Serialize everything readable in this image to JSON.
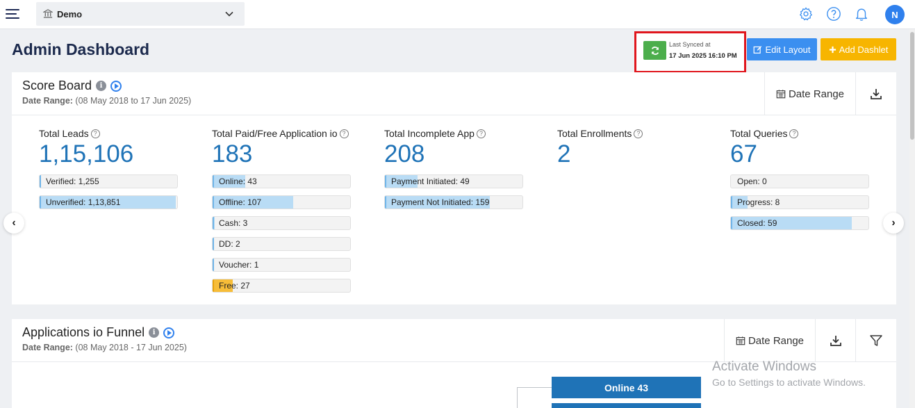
{
  "topbar": {
    "institution": "Demo",
    "avatar_initial": "N"
  },
  "page_title": "Admin Dashboard",
  "sync": {
    "label": "Last Synced at",
    "time": "17 Jun 2025 16:10 PM"
  },
  "buttons": {
    "edit_layout": "Edit Layout",
    "add_dashlet": "Add Dashlet"
  },
  "scoreboard": {
    "title": "Score Board",
    "date_label": "Date Range:",
    "date_value": "(08 May 2018 to 17 Jun 2025)",
    "date_range_btn": "Date Range",
    "stats": [
      {
        "label": "Total Leads",
        "value": "1,15,106",
        "bars": [
          {
            "text": "Verified: 1,255",
            "fill": 0.01,
            "color": "blue"
          },
          {
            "text": "Unverified: 1,13,851",
            "fill": 0.99,
            "color": "blue"
          }
        ]
      },
      {
        "label": "Total Paid/Free Application io",
        "value": "183",
        "bars": [
          {
            "text": "Online: 43",
            "fill": 0.235,
            "color": "blue"
          },
          {
            "text": "Offline: 107",
            "fill": 0.585,
            "color": "blue"
          },
          {
            "text": "Cash: 3",
            "fill": 0.016,
            "color": "blue"
          },
          {
            "text": "DD: 2",
            "fill": 0.011,
            "color": "blue"
          },
          {
            "text": "Voucher: 1",
            "fill": 0.005,
            "color": "blue"
          },
          {
            "text": "Free: 27",
            "fill": 0.148,
            "color": "orange"
          }
        ]
      },
      {
        "label": "Total Incomplete App",
        "value": "208",
        "bars": [
          {
            "text": "Payment Initiated: 49",
            "fill": 0.236,
            "color": "blue"
          },
          {
            "text": "Payment Not Initiated: 159",
            "fill": 0.764,
            "color": "blue"
          }
        ]
      },
      {
        "label": "Total Enrollments",
        "value": "2",
        "bars": []
      },
      {
        "label": "Total Queries",
        "value": "67",
        "bars": [
          {
            "text": "Open: 0",
            "fill": 0,
            "color": "blue"
          },
          {
            "text": "Progress: 8",
            "fill": 0.119,
            "color": "blue"
          },
          {
            "text": "Closed: 59",
            "fill": 0.881,
            "color": "blue"
          }
        ]
      }
    ]
  },
  "funnel": {
    "title": "Applications io Funnel",
    "date_label": "Date Range:",
    "date_value": "(08 May 2018 - 17 Jun 2025)",
    "date_range_btn": "Date Range",
    "bars": [
      {
        "label": "Online 43"
      },
      {
        "label": ""
      }
    ]
  },
  "watermark": {
    "line1": "Activate Windows",
    "line2": "Go to Settings to activate Windows."
  },
  "arrows": {
    "prev": "‹",
    "next": "›"
  },
  "colors": {
    "primary": "#1f73b7",
    "sync_green": "#4cae4c",
    "edit_blue": "#3b8ff0",
    "add_yellow": "#f7b500",
    "highlight_red": "#e0161d"
  }
}
